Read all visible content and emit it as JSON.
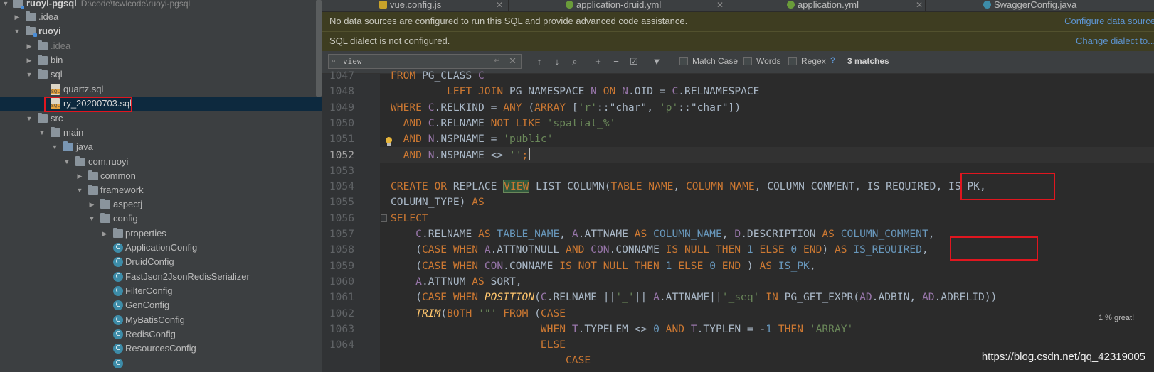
{
  "project_tree": {
    "root": {
      "label": "ruoyi-pgsql",
      "path": "D:\\code\\tcwlcode\\ruoyi-pgsql"
    },
    "items": [
      {
        "label": ".idea",
        "depth": 1,
        "expanded": false,
        "kind": "folder"
      },
      {
        "label": "ruoyi",
        "depth": 1,
        "expanded": true,
        "kind": "module"
      },
      {
        "label": ".idea",
        "depth": 2,
        "expanded": false,
        "kind": "folder"
      },
      {
        "label": "bin",
        "depth": 2,
        "expanded": false,
        "kind": "folder"
      },
      {
        "label": "sql",
        "depth": 2,
        "expanded": true,
        "kind": "folder"
      },
      {
        "label": "quartz.sql",
        "depth": 3,
        "kind": "sql"
      },
      {
        "label": "ry_20200703.sql",
        "depth": 3,
        "kind": "sql",
        "selected": true
      },
      {
        "label": "src",
        "depth": 2,
        "expanded": true,
        "kind": "folder"
      },
      {
        "label": "main",
        "depth": 3,
        "expanded": true,
        "kind": "folder"
      },
      {
        "label": "java",
        "depth": 4,
        "expanded": true,
        "kind": "source"
      },
      {
        "label": "com.ruoyi",
        "depth": 5,
        "expanded": true,
        "kind": "package"
      },
      {
        "label": "common",
        "depth": 6,
        "expanded": false,
        "kind": "package"
      },
      {
        "label": "framework",
        "depth": 6,
        "expanded": true,
        "kind": "package"
      },
      {
        "label": "aspectj",
        "depth": 7,
        "expanded": false,
        "kind": "package"
      },
      {
        "label": "config",
        "depth": 7,
        "expanded": true,
        "kind": "package"
      },
      {
        "label": "properties",
        "depth": 8,
        "expanded": false,
        "kind": "package"
      },
      {
        "label": "ApplicationConfig",
        "depth": 8,
        "kind": "class"
      },
      {
        "label": "DruidConfig",
        "depth": 8,
        "kind": "class"
      },
      {
        "label": "FastJson2JsonRedisSerializer",
        "depth": 8,
        "kind": "class"
      },
      {
        "label": "FilterConfig",
        "depth": 8,
        "kind": "class"
      },
      {
        "label": "GenConfig",
        "depth": 8,
        "kind": "class"
      },
      {
        "label": "MyBatisConfig",
        "depth": 8,
        "kind": "class"
      },
      {
        "label": "RedisConfig",
        "depth": 8,
        "kind": "class"
      },
      {
        "label": "ResourcesConfig",
        "depth": 8,
        "kind": "class"
      }
    ]
  },
  "editor_tabs": [
    {
      "label": "vue.config.js",
      "icon": "js-file-icon"
    },
    {
      "label": "application-druid.yml",
      "icon": "yml-file-icon"
    },
    {
      "label": "application.yml",
      "icon": "yml-file-icon"
    },
    {
      "label": "SwaggerConfig.java",
      "icon": "java-class-icon"
    }
  ],
  "banners": [
    {
      "text": "No data sources are configured to run this SQL and provide advanced code assistance.",
      "link": "Configure data source"
    },
    {
      "text": "SQL dialect is not configured.",
      "link": "Change dialect to..."
    }
  ],
  "find_bar": {
    "query": "view",
    "match_case": "Match Case",
    "words": "Words",
    "regex": "Regex",
    "help": "?",
    "matches": "3 matches"
  },
  "line_numbers": [
    "1047",
    "1048",
    "1049",
    "1050",
    "1051",
    "1052",
    "1053",
    "1054",
    "1055",
    "1056",
    "1057",
    "1058",
    "1059",
    "1060",
    "1061",
    "1062",
    "1063",
    "1064"
  ],
  "usage": "1 % great!",
  "watermark": "https://blog.csdn.net/qq_42319005",
  "colors": {
    "keyword": "#cc7832",
    "string": "#6a8759",
    "number": "#6897bb",
    "column": "#9876aa",
    "function": "#ffc66d",
    "highlight_box": "#e0161f"
  }
}
